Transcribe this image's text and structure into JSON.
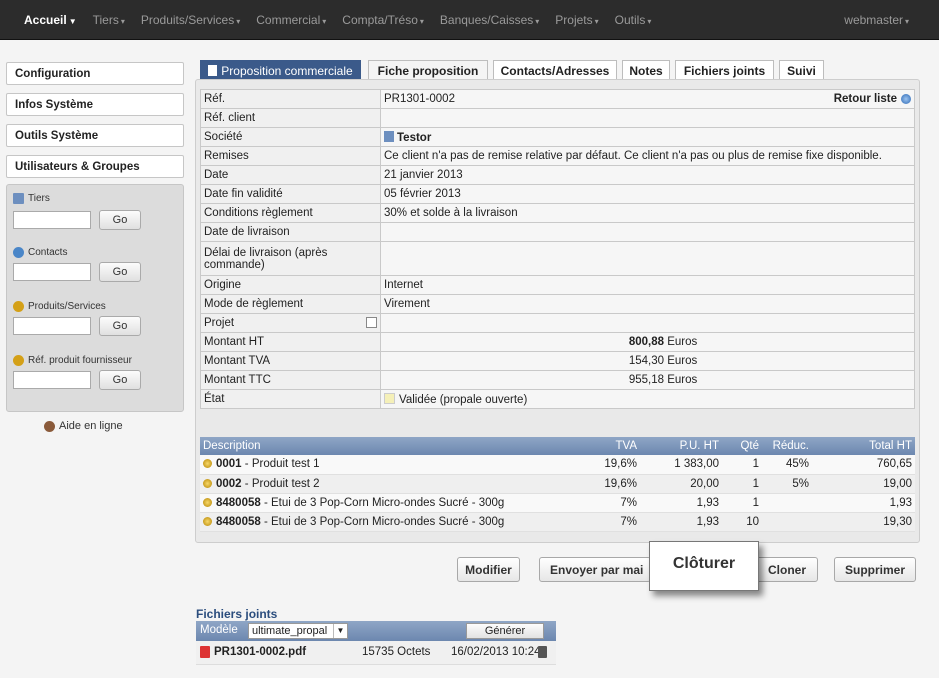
{
  "nav": {
    "items": [
      "Accueil",
      "Tiers",
      "Produits/Services",
      "Commercial",
      "Compta/Tréso",
      "Banques/Caisses",
      "Projets",
      "Outils"
    ],
    "user": "webmaster"
  },
  "sidebar": {
    "buttons": [
      "Configuration",
      "Infos Système",
      "Outils Système",
      "Utilisateurs & Groupes"
    ],
    "search": [
      {
        "label": "Tiers",
        "go": "Go"
      },
      {
        "label": "Contacts",
        "go": "Go"
      },
      {
        "label": "Produits/Services",
        "go": "Go"
      },
      {
        "label": "Réf. produit fournisseur",
        "go": "Go"
      }
    ],
    "help": "Aide en ligne"
  },
  "tabs": [
    "Proposition commerciale",
    "Fiche proposition",
    "Contacts/Adresses",
    "Notes",
    "Fichiers joints",
    "Suivi"
  ],
  "info": {
    "back": "Retour liste",
    "rows": [
      {
        "k": "Réf.",
        "v": "PR1301-0002"
      },
      {
        "k": "Réf. client",
        "v": ""
      },
      {
        "k": "Société",
        "v": "Testor"
      },
      {
        "k": "Remises",
        "v": "Ce client n'a pas de remise relative par défaut. Ce client n'a pas ou plus de remise fixe disponible."
      },
      {
        "k": "Date",
        "v": "21 janvier 2013"
      },
      {
        "k": "Date fin validité",
        "v": "05 février 2013"
      },
      {
        "k": "Conditions règlement",
        "v": "30% et solde à la livraison"
      },
      {
        "k": "Date de livraison",
        "v": ""
      },
      {
        "k": "Délai de livraison (après commande)",
        "v": ""
      },
      {
        "k": "Origine",
        "v": "Internet"
      },
      {
        "k": "Mode de règlement",
        "v": "Virement"
      },
      {
        "k": "Projet",
        "v": ""
      },
      {
        "k": "Montant HT",
        "v": "800,88",
        "u": "Euros"
      },
      {
        "k": "Montant TVA",
        "v": "154,30",
        "u": "Euros"
      },
      {
        "k": "Montant TTC",
        "v": "955,18",
        "u": "Euros"
      },
      {
        "k": "État",
        "v": "Validée (propale ouverte)"
      }
    ]
  },
  "lines": {
    "headers": [
      "Description",
      "TVA",
      "P.U. HT",
      "Qté",
      "Réduc.",
      "Total HT"
    ],
    "rows": [
      {
        "ref": "0001",
        "desc": " - Produit test 1",
        "tva": "19,6%",
        "pu": "1 383,00",
        "qty": "1",
        "red": "45%",
        "tot": "760,65"
      },
      {
        "ref": "0002",
        "desc": " - Produit test 2",
        "tva": "19,6%",
        "pu": "20,00",
        "qty": "1",
        "red": "5%",
        "tot": "19,00"
      },
      {
        "ref": "8480058",
        "desc": " - Etui de 3 Pop-Corn Micro-ondes Sucré - 300g",
        "tva": "7%",
        "pu": "1,93",
        "qty": "1",
        "red": "",
        "tot": "1,93"
      },
      {
        "ref": "8480058",
        "desc": " - Etui de 3 Pop-Corn Micro-ondes Sucré - 300g",
        "tva": "7%",
        "pu": "1,93",
        "qty": "10",
        "red": "",
        "tot": "19,30"
      }
    ]
  },
  "actions": {
    "modify": "Modifier",
    "send": "Envoyer par mai",
    "close": "Clôturer",
    "clone": "Cloner",
    "delete": "Supprimer"
  },
  "files": {
    "title": "Fichiers joints",
    "model_label": "Modèle",
    "model_value": "ultimate_propal",
    "generate": "Générer",
    "file": {
      "name": "PR1301-0002.pdf",
      "size": "15735 Octets",
      "date": "16/02/2013 10:24"
    }
  },
  "colors": {
    "nav_bg": "#2c2c2c",
    "accent": "#3b5a8a",
    "header_blue": "#6c87af"
  }
}
